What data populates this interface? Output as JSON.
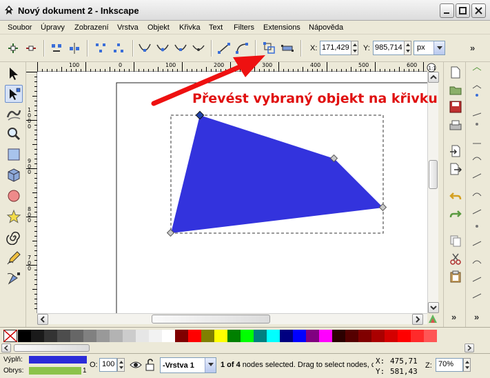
{
  "window": {
    "title": "Nový dokument 2 - Inkscape"
  },
  "menu": [
    "Soubor",
    "Úpravy",
    "Zobrazení",
    "Vrstva",
    "Objekt",
    "Křivka",
    "Text",
    "Filters",
    "Extensions",
    "Nápověda"
  ],
  "toolbar": {
    "x_label": "X:",
    "x_value": "171,429",
    "y_label": "Y:",
    "y_value": "985,714",
    "unit": "px",
    "overflow": "»"
  },
  "ruler": {
    "top_labels": [
      "100",
      "0",
      "100",
      "200",
      "300",
      "400",
      "500",
      "600"
    ],
    "left_labels": [
      "1000",
      "900",
      "800",
      "700"
    ]
  },
  "annotation": {
    "text": "Převést vybraný objekt na křivku",
    "color": "#e01010"
  },
  "shape": {
    "fill": "#3333dd"
  },
  "palette": {
    "colors": [
      "#000000",
      "#1a1a1a",
      "#333333",
      "#4d4d4d",
      "#666666",
      "#808080",
      "#999999",
      "#b3b3b3",
      "#cccccc",
      "#e6e6e6",
      "#f2f2f2",
      "#ffffff",
      "#800000",
      "#ff0000",
      "#808000",
      "#ffff00",
      "#008000",
      "#00ff00",
      "#008080",
      "#00ffff",
      "#000080",
      "#0000ff",
      "#800080",
      "#ff00ff",
      "#2b0000",
      "#550000",
      "#800000",
      "#aa0000",
      "#d40000",
      "#ff0000",
      "#ff2a2a",
      "#ff5555"
    ]
  },
  "status": {
    "fill_label": "Výplň:",
    "stroke_label": "Obrys:",
    "fill_color": "#2b2bd9",
    "stroke_color": "#8bc34a",
    "stroke_width": "1",
    "opacity_label": "O:",
    "opacity_value": "100",
    "layer": "-Vrstva 1",
    "message_bold": "1 of 4",
    "message": " nodes selected. Drag to select nodes, c",
    "x_label": "X:",
    "x_value": "475,71",
    "y_label": "Y:",
    "y_value": "581,43",
    "zoom_label": "Z:",
    "zoom_value": "70%"
  }
}
